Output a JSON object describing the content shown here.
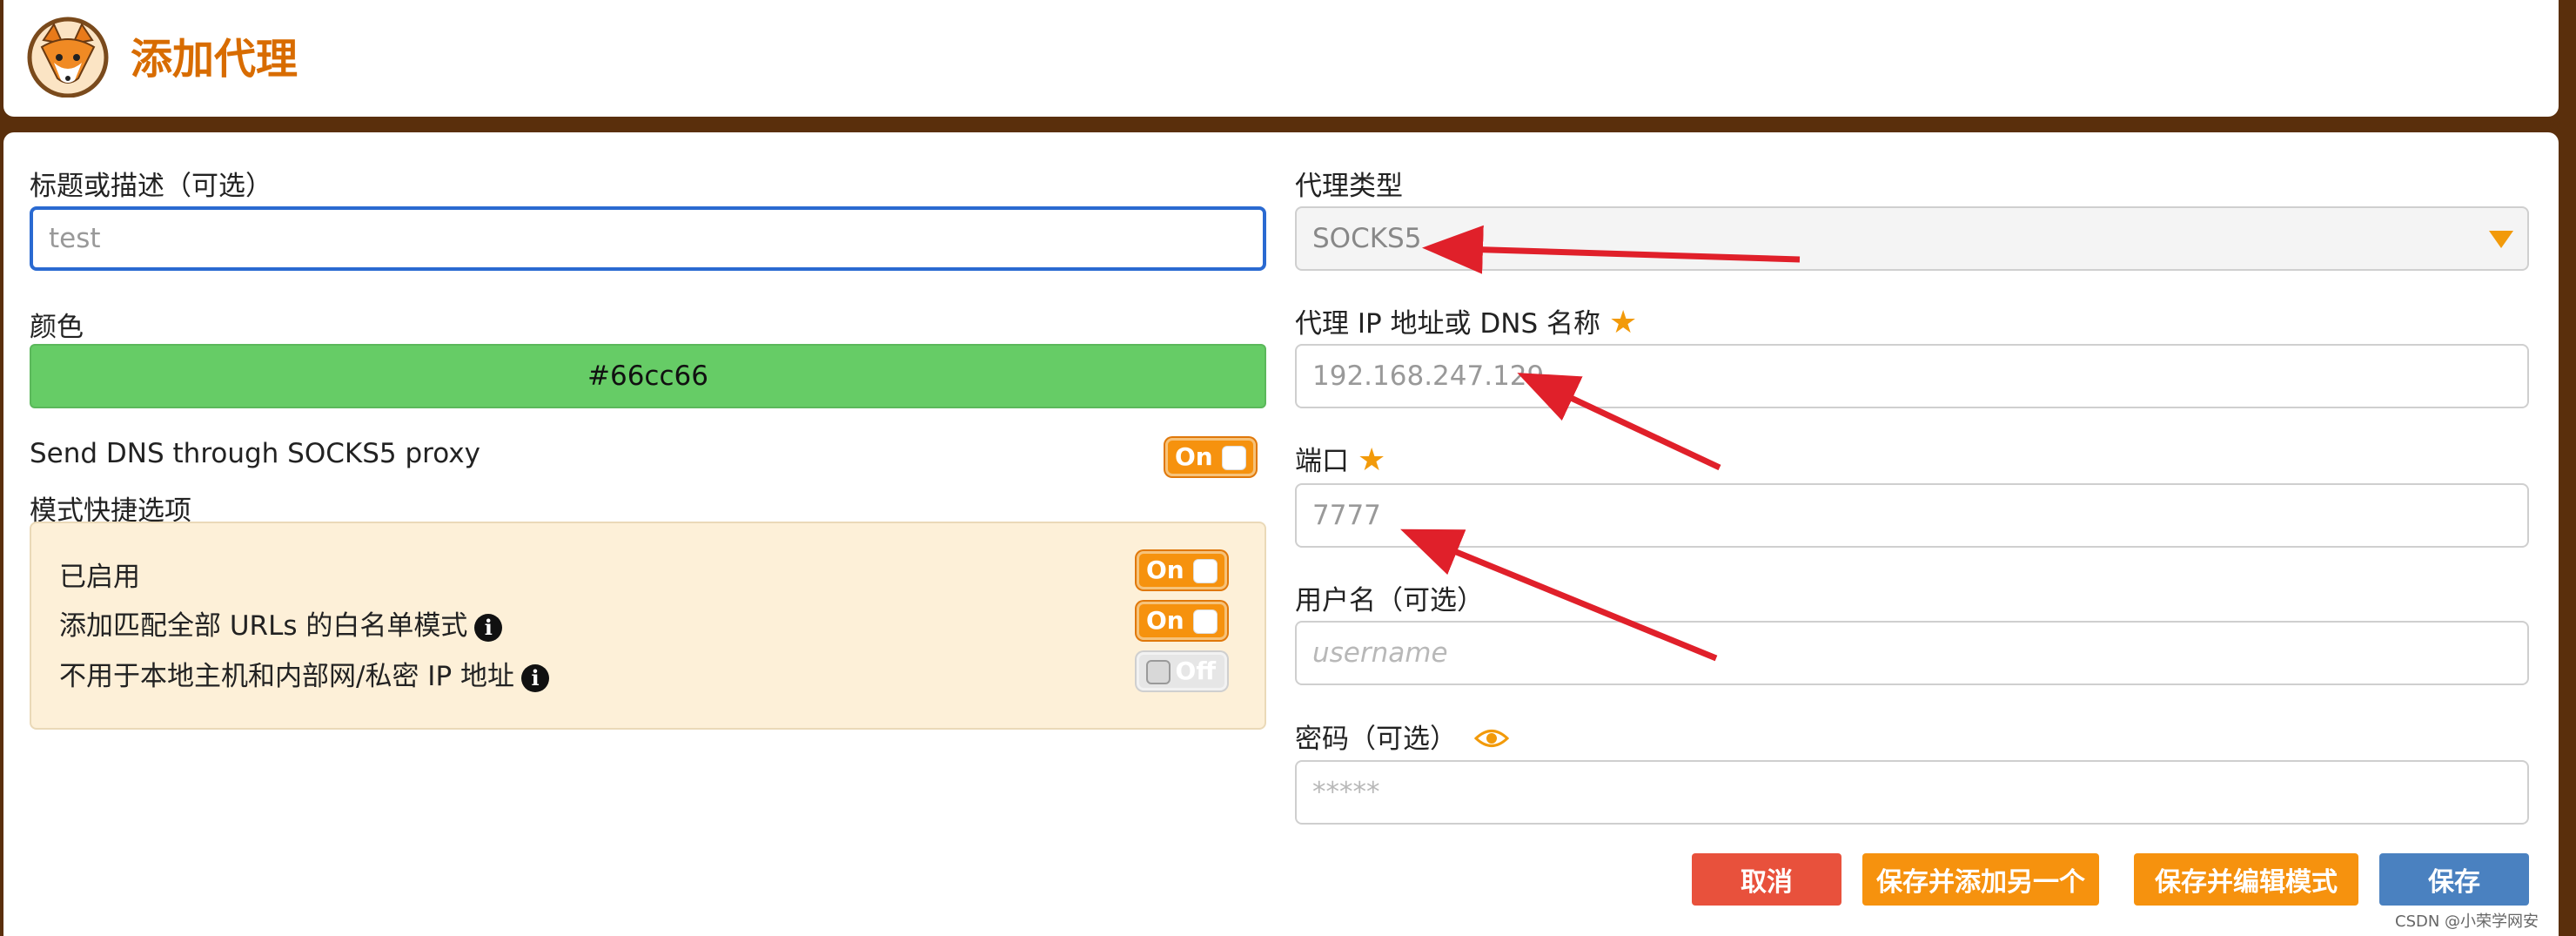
{
  "header": {
    "title": "添加代理",
    "logo_icon": "fox-logo-icon"
  },
  "form": {
    "title_label": "标题或描述（可选）",
    "title_value": "test",
    "color_label": "颜色",
    "color_value": "#66cc66",
    "dns_label": "Send DNS through SOCKS5 proxy",
    "dns_toggle": "On",
    "pattern_label": "模式快捷选项",
    "patterns": [
      {
        "label": "已启用",
        "toggle": "On",
        "info": false
      },
      {
        "label": "添加匹配全部 URLs 的白名单模式",
        "toggle": "On",
        "info": true
      },
      {
        "label": "不用于本地主机和内部网/私密 IP 地址",
        "toggle": "Off",
        "info": true
      }
    ],
    "type_label": "代理类型",
    "type_value": "SOCKS5",
    "host_label": "代理 IP 地址或 DNS 名称",
    "host_value": "192.168.247.129",
    "port_label": "端口",
    "port_value": "7777",
    "user_label": "用户名（可选）",
    "user_placeholder": "username",
    "pass_label": "密码（可选）",
    "pass_placeholder": "*****"
  },
  "buttons": {
    "cancel": "取消",
    "save_add": "保存并添加另一个",
    "save_edit": "保存并编辑模式",
    "save": "保存"
  },
  "watermark": "CSDN @小荣学网安",
  "colors": {
    "background": "#5a2f0c",
    "accent": "#f6920e",
    "title": "#d86c00",
    "cancel": "#e8513c",
    "save": "#4a81c0",
    "annotation_arrow": "#e0202a"
  }
}
